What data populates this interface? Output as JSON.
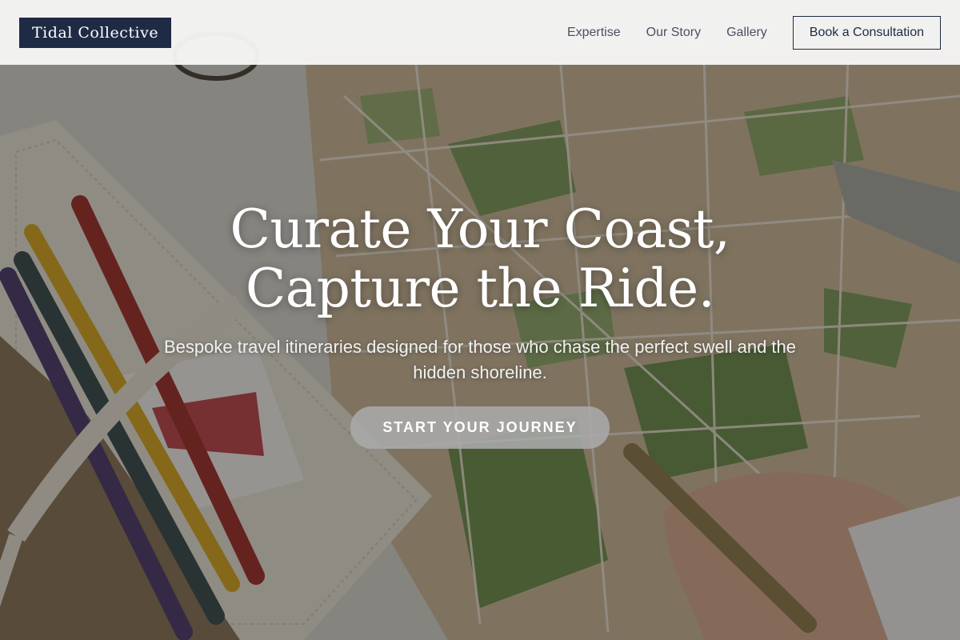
{
  "navbar": {
    "brand": "Tidal Collective",
    "links": [
      "Expertise",
      "Our Story",
      "Gallery"
    ],
    "cta_label": "Book a Consultation"
  },
  "hero": {
    "title_line1": "Curate Your Coast,",
    "title_line2": "Capture the Ride.",
    "subtitle": "Bespoke travel itineraries designed for those who chase the perfect swell and the hidden shoreline.",
    "cta_label": "START YOUR JOURNEY",
    "background_description_icon": "map-desk-photo"
  },
  "colors": {
    "brand_bg": "#1f2a44",
    "nav_bg": "#f6f6f5",
    "cta_pill": "#aaaaaa"
  }
}
